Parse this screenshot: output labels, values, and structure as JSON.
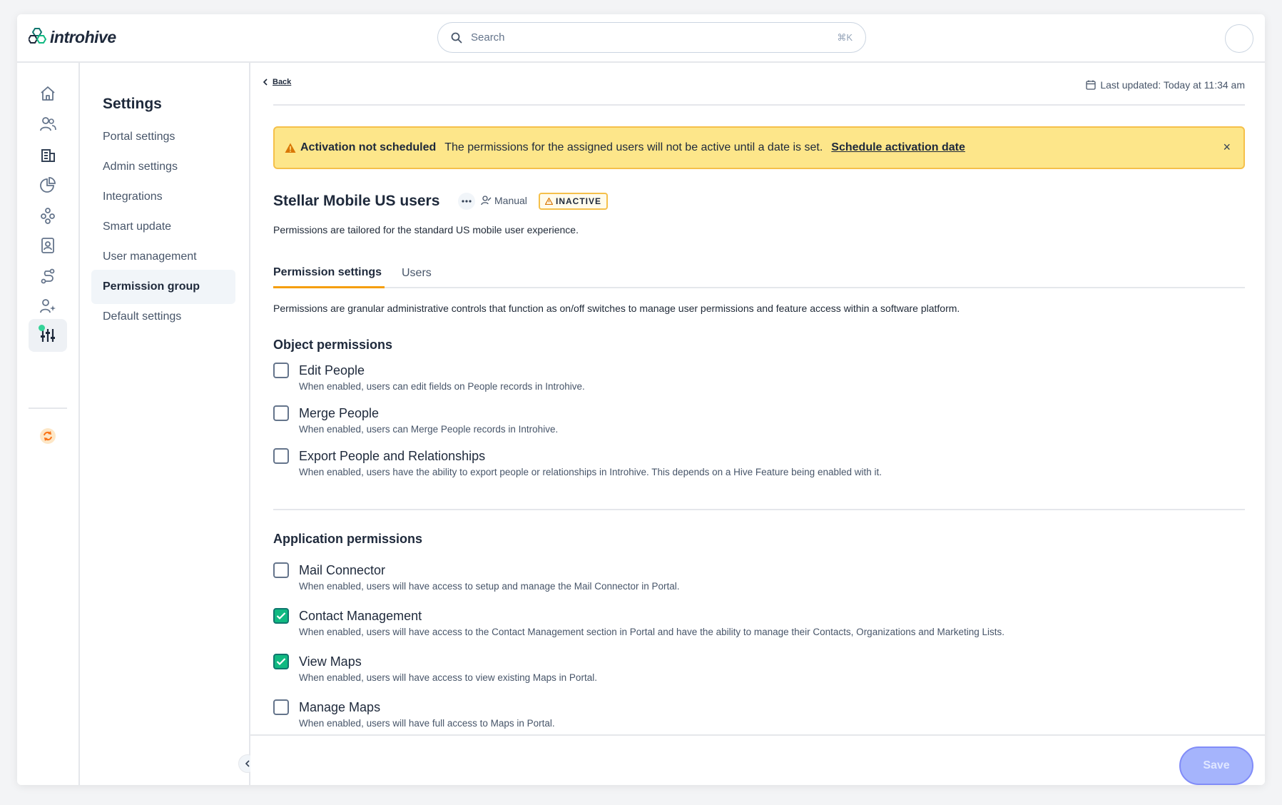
{
  "brand": {
    "name": "introhive"
  },
  "search": {
    "placeholder": "Search",
    "shortcut": "⌘K"
  },
  "rail": [
    "home-icon",
    "people-icon",
    "building-icon",
    "chart-icon",
    "hive-icon",
    "contact-book-icon",
    "route-icon",
    "user-sparkle-icon",
    "sliders-icon",
    "sync-icon"
  ],
  "settings": {
    "title": "Settings",
    "items": [
      {
        "label": "Portal settings"
      },
      {
        "label": "Admin settings"
      },
      {
        "label": "Integrations"
      },
      {
        "label": "Smart update"
      },
      {
        "label": "User management"
      },
      {
        "label": "Permission group"
      },
      {
        "label": "Default settings"
      }
    ]
  },
  "header": {
    "back": "Back",
    "last_updated": "Last updated: Today at 11:34 am"
  },
  "banner": {
    "title": "Activation not scheduled",
    "message": "The permissions for the assigned users will not be active until a date is set.",
    "link": "Schedule activation date",
    "close": "×"
  },
  "group": {
    "title": "Stellar Mobile US users",
    "mode": "Manual",
    "status": "INACTIVE",
    "description": "Permissions are tailored for the standard US mobile user experience."
  },
  "tabs": {
    "permission_settings": "Permission settings",
    "users": "Users"
  },
  "intro": "Permissions are granular administrative controls that function as on/off switches to manage user permissions and feature access within a software platform.",
  "object_permissions": {
    "title": "Object permissions",
    "items": [
      {
        "title": "Edit People",
        "desc": "When enabled, users can edit fields on People records in Introhive.",
        "checked": false
      },
      {
        "title": "Merge People",
        "desc": "When enabled, users can Merge People records in Introhive.",
        "checked": false
      },
      {
        "title": "Export People and Relationships",
        "desc": "When enabled, users have the ability to export people or relationships in Introhive. This depends on a Hive Feature being enabled with it.",
        "checked": false
      }
    ]
  },
  "application_permissions": {
    "title": "Application permissions",
    "items": [
      {
        "title": "Mail Connector",
        "desc": "When enabled, users will have access to setup and manage the Mail Connector in Portal.",
        "checked": false
      },
      {
        "title": "Contact Management",
        "desc": "When enabled, users will have access to the Contact Management section in Portal and have the ability to manage their Contacts, Organizations and Marketing Lists.",
        "checked": true
      },
      {
        "title": "View Maps",
        "desc": "When enabled, users will have access to view existing Maps in Portal.",
        "checked": true
      },
      {
        "title": "Manage Maps",
        "desc": "When enabled, users will have full access to Maps in Portal.",
        "checked": false
      }
    ]
  },
  "footer": {
    "save": "Save"
  },
  "colors": {
    "accent": "#f59e0b",
    "check": "#10b981",
    "banner": "#fde68a",
    "save": "#a5b4fc"
  }
}
